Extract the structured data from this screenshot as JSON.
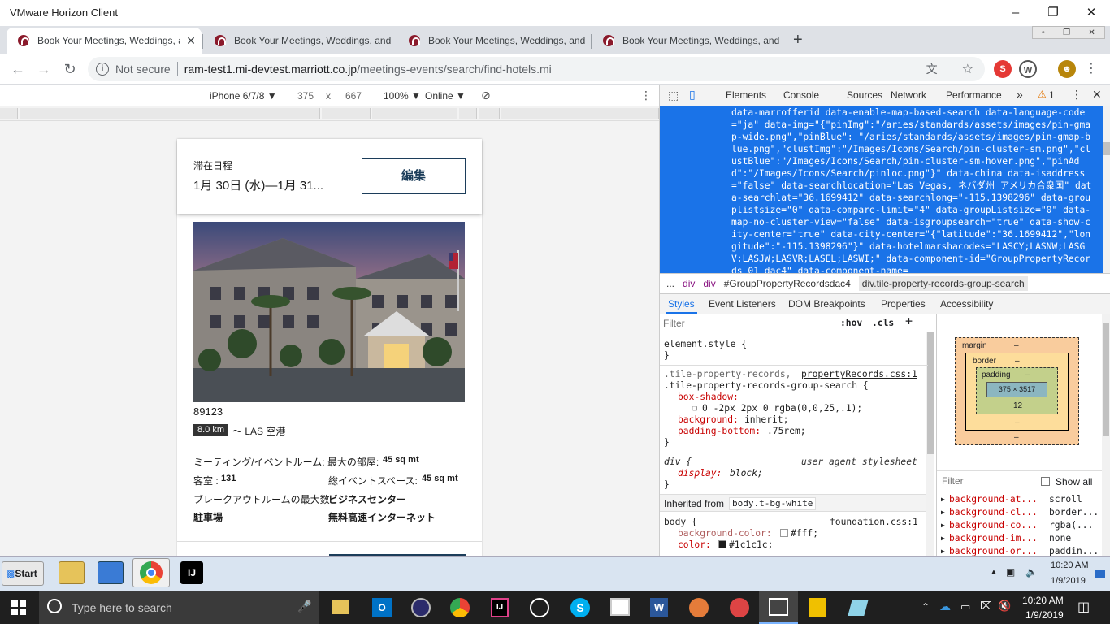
{
  "window": {
    "title": "VMware Horizon Client"
  },
  "tabs": [
    {
      "label": "Book Your Meetings, Weddings, and",
      "active": true
    },
    {
      "label": "Book Your Meetings, Weddings, and",
      "active": false
    },
    {
      "label": "Book Your Meetings, Weddings, and",
      "active": false
    },
    {
      "label": "Book Your Meetings, Weddings, and",
      "active": false
    }
  ],
  "omnibox": {
    "security": "Not secure",
    "domain": "ram-test1.mi-devtest.marriott.co.jp",
    "path": "/meetings-events/search/find-hotels.mi"
  },
  "device_toolbar": {
    "device": "iPhone 6/7/8 ▼",
    "width": "375",
    "times": "x",
    "height": "667",
    "zoom": "100% ▼",
    "network": "Online ▼"
  },
  "page": {
    "stay_label": "滞在日程",
    "stay_dates": "1月 30日 (水)—1月 31...",
    "edit_button": "編集",
    "zip": "89123",
    "distance_badge": "8.0 km",
    "distance_text": "～ LAS 空港",
    "facts": [
      {
        "label": "ミーティング/イベントルーム: 最大の部屋:",
        "value": "45 sq mt"
      },
      {
        "label": "客室 :",
        "value": "131"
      },
      {
        "label": "総イベントスペース:",
        "value": "45 sq mt"
      },
      {
        "label": "ブレークアウトルームの最大数",
        "value": ""
      },
      {
        "label": "ビジネスセンター",
        "value": ""
      },
      {
        "label": "駐車場",
        "value": ""
      },
      {
        "label": "無料高速インターネット",
        "value": ""
      }
    ]
  },
  "devtools": {
    "tabs": [
      "Elements",
      "Console",
      "Sources",
      "Network",
      "Performance"
    ],
    "warn_count": "1",
    "code": "data-marrofferid data-enable-map-based-search data-language-code=\"ja\" data-img=\"{\"pinImg\":\"/aries/standards/assets/images/pin-gmap-wide.png\",\"pinBlue\": \"/aries/standards/assets/images/pin-gmap-blue.png\",\"clustImg\":\"/Images/Icons/Search/pin-cluster-sm.png\",\"clustBlue\":\"/Images/Icons/Search/pin-cluster-sm-hover.png\",\"pinAdd\":\"/Images/Icons/Search/pinloc.png\"}\" data-china data-isaddress=\"false\" data-searchlocation=\"Las Vegas, ネバダ州 アメリカ合衆国\" data-searchlat=\"36.1699412\" data-searchlong=\"-115.1398296\" data-grouplistsize=\"0\" data-compare-limit=\"4\" data-groupListsize=\"0\" data-map-no-cluster-view=\"false\" data-isgroupsearch=\"true\" data-show-city-center=\"true\" data-city-center=\"{\"latitude\":\"36.1699412\",\"longitude\":\"-115.1398296\"}\" data-hotelmarshacodes=\"LASCY;LASNW;LASGV;LASJW;LASVR;LASEL;LASWI;\" data-component-id=\"GroupPropertyRecords_01_dac4\" data-component-name=",
    "breadcrumbs": [
      "...",
      "div",
      "div",
      "#GroupPropertyRecordsdac4",
      "div.tile-property-records-group-search"
    ],
    "subtabs": [
      "Styles",
      "Event Listeners",
      "DOM Breakpoints",
      "Properties",
      "Accessibility"
    ],
    "filter_placeholder": "Filter",
    "hov": ":hov",
    "cls": ".cls",
    "rules": {
      "element_style": "element.style {",
      "close": "}",
      "sel1": ".tile-property-records,",
      "sel2": ".tile-property-records-group-search {",
      "src1": "propertyRecords.css:1",
      "p1n": "box-shadow:",
      "p1v": "0 -2px 2px 0 rgba(0,0,25,.1);",
      "p2n": "background:",
      "p2v": "inherit;",
      "p3n": "padding-bottom:",
      "p3v": ".75rem;",
      "div_sel": "div {",
      "ua": "user agent stylesheet",
      "p4n": "display:",
      "p4v": "block;",
      "inherited": "Inherited from",
      "inh_el": "body.t-bg-white",
      "body_sel": "body {",
      "src2": "foundation.css:1",
      "p5n": "background-color:",
      "p5v": "#fff;",
      "p6n": "color:",
      "p6v": "#1c1c1c;"
    },
    "boxmodel": {
      "margin": "margin",
      "border": "border",
      "padding": "padding",
      "dash": "–",
      "content": "375 × 3517",
      "pad_bottom": "12"
    },
    "computed": {
      "filter": "Filter",
      "show_all": "Show all",
      "props": [
        {
          "name": "background-at...",
          "value": "scroll"
        },
        {
          "name": "background-cl...",
          "value": "border..."
        },
        {
          "name": "background-co...",
          "value": "rgba(..."
        },
        {
          "name": "background-im...",
          "value": "none"
        },
        {
          "name": "background-or...",
          "value": "paddin..."
        }
      ]
    }
  },
  "remote_taskbar": {
    "start": "Start",
    "time": "10:20 AM",
    "date": "1/9/2019"
  },
  "windows_taskbar": {
    "search_placeholder": "Type here to search",
    "time": "10:20 AM",
    "date": "1/9/2019"
  },
  "colors": {
    "accent": "#1a73e8",
    "marriott": "#8b1a2b",
    "selection": "#1a73e8"
  }
}
